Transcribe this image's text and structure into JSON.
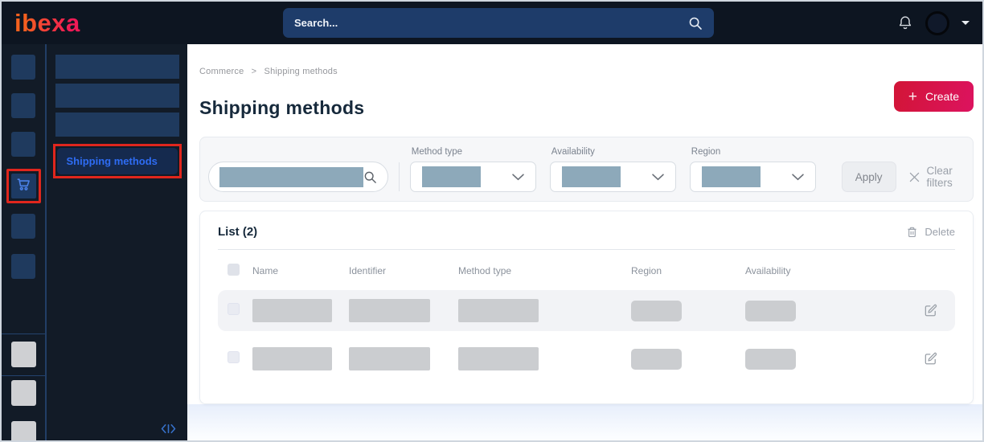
{
  "topbar": {
    "logo_text": "ibexa",
    "search_placeholder": "Search..."
  },
  "sidebar": {
    "active_item_label": "Shipping methods"
  },
  "breadcrumb": {
    "items": [
      "Commerce",
      "Shipping methods"
    ],
    "separator": ">"
  },
  "page": {
    "title": "Shipping methods",
    "create_button_label": "Create",
    "create_button_plus": "+"
  },
  "filter_bar": {
    "method_type_label": "Method type",
    "availability_label": "Availability",
    "region_label": "Region",
    "apply_button_label": "Apply",
    "clear_filters_label": "Clear filters"
  },
  "list_panel": {
    "title": "List (2)",
    "delete_button_label": "Delete",
    "columns": [
      "Name",
      "Identifier",
      "Method type",
      "Region",
      "Availability"
    ],
    "row_count": 2
  },
  "colors": {
    "accent_highlight_red": "#e0261d",
    "create_gradient_start": "#d21537",
    "create_gradient_end": "#dc135f",
    "active_link_blue": "#2e6cf3",
    "cart_icon_blue": "#4b82ea",
    "redacted_filter_block": "#8da9ba",
    "redacted_cell_block": "#cbcdd0",
    "navy_placeholder_tile": "#1f3a5e",
    "topbar_bg": "#0d1521",
    "sidebar_bg": "#121b27",
    "search_bar_bg": "#1e3c6a"
  }
}
